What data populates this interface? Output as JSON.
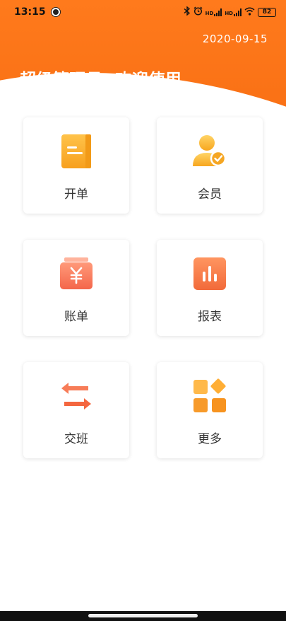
{
  "status_bar": {
    "time": "13:15",
    "battery": "82",
    "network_1": "HD",
    "network_2": "HD"
  },
  "header": {
    "date": "2020-09-15",
    "welcome": "超级管理员, 欢迎使用",
    "color": "#f56a10"
  },
  "menu": {
    "items": [
      {
        "label": "开单",
        "icon": "document-icon"
      },
      {
        "label": "会员",
        "icon": "member-icon"
      },
      {
        "label": "账单",
        "icon": "bill-yen-icon"
      },
      {
        "label": "报表",
        "icon": "report-chart-icon"
      },
      {
        "label": "交班",
        "icon": "shift-swap-icon"
      },
      {
        "label": "更多",
        "icon": "more-grid-icon"
      }
    ]
  }
}
